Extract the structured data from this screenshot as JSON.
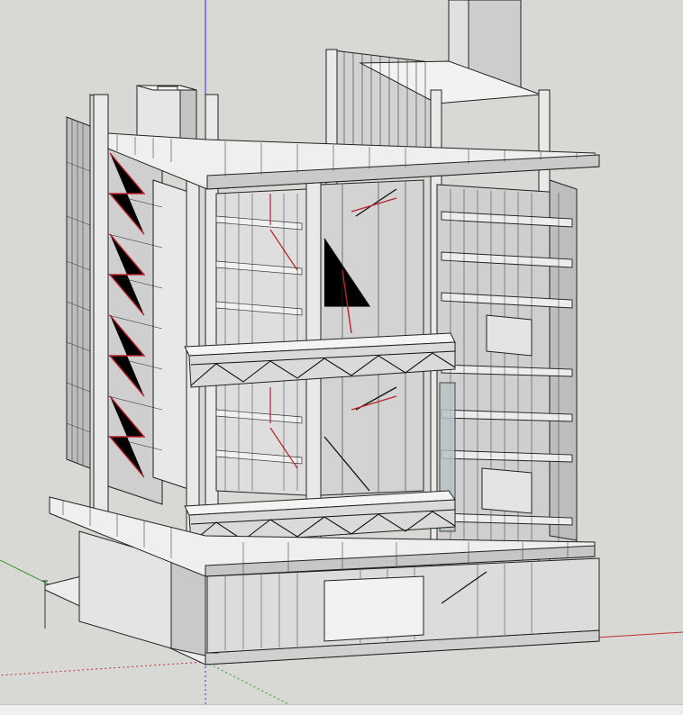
{
  "app": {
    "view": "3d-model-viewport",
    "background_color": "#d8d8d4"
  },
  "colors": {
    "edge": "#222222",
    "face_light": "#f2f2f2",
    "face_mid": "#d6d6d6",
    "face_dark": "#b9b9b9",
    "glass": "#c8d0d2",
    "stair_highlight": "#c0202a",
    "axis_red": "#c03030",
    "axis_green": "#2f9a2f",
    "axis_blue": "#2b2bd0"
  },
  "model": {
    "description_icon": "building-model-icon"
  },
  "statusbar": {
    "text": ""
  }
}
